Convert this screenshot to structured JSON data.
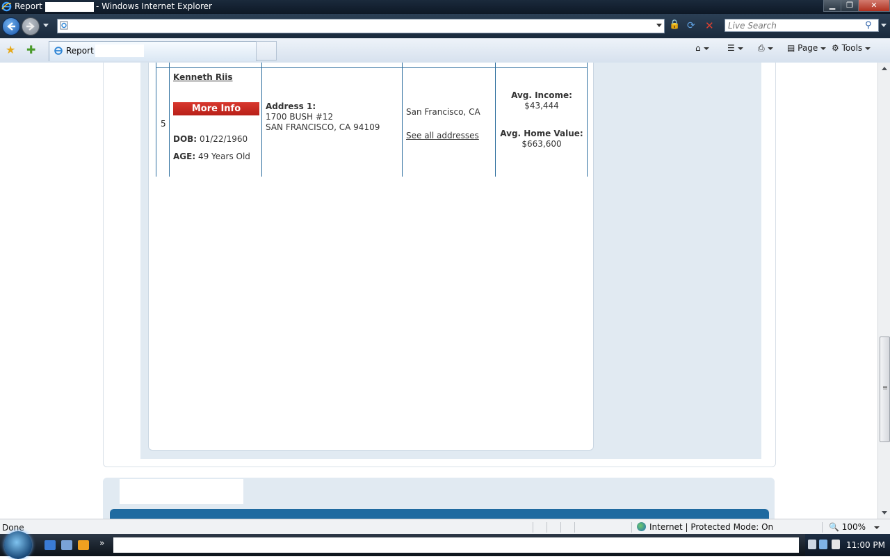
{
  "window": {
    "title_prefix": "Report -",
    "title_suffix": "- Windows Internet Explorer",
    "min_glyph": "▁",
    "max_glyph": "❐",
    "close_glyph": "✕"
  },
  "address_bar": {
    "url": "",
    "search_placeholder": "Live Search"
  },
  "tab": {
    "label": "Report -"
  },
  "command_bar": {
    "page_label": "Page",
    "tools_label": "Tools"
  },
  "record": {
    "row_number": "5",
    "name": "Kenneth Riis",
    "more_info_label": "More Info",
    "dob_label": "DOB:",
    "dob_value": "01/22/1960",
    "age_label": "AGE:",
    "age_value": "49 Years Old",
    "address_label": "Address 1:",
    "address_line1": "1700 BUSH #12",
    "address_line2": "SAN FRANCISCO, CA 94109",
    "city": "San Francisco, CA",
    "see_all_label": "See all addresses",
    "avg_income_label": "Avg. Income:",
    "avg_income_value": "$43,444",
    "avg_home_label": "Avg. Home Value:",
    "avg_home_value": "$663,600"
  },
  "status_bar": {
    "status": "Done",
    "zone": "Internet | Protected Mode: On",
    "zoom": "100%"
  },
  "taskbar": {
    "clock": "11:00 PM"
  },
  "colors": {
    "table_border": "#2f6f9f",
    "more_info_button": "#c8281f",
    "panel_bg": "#e1eaf2",
    "bottom_bar": "#1f6aa0"
  }
}
